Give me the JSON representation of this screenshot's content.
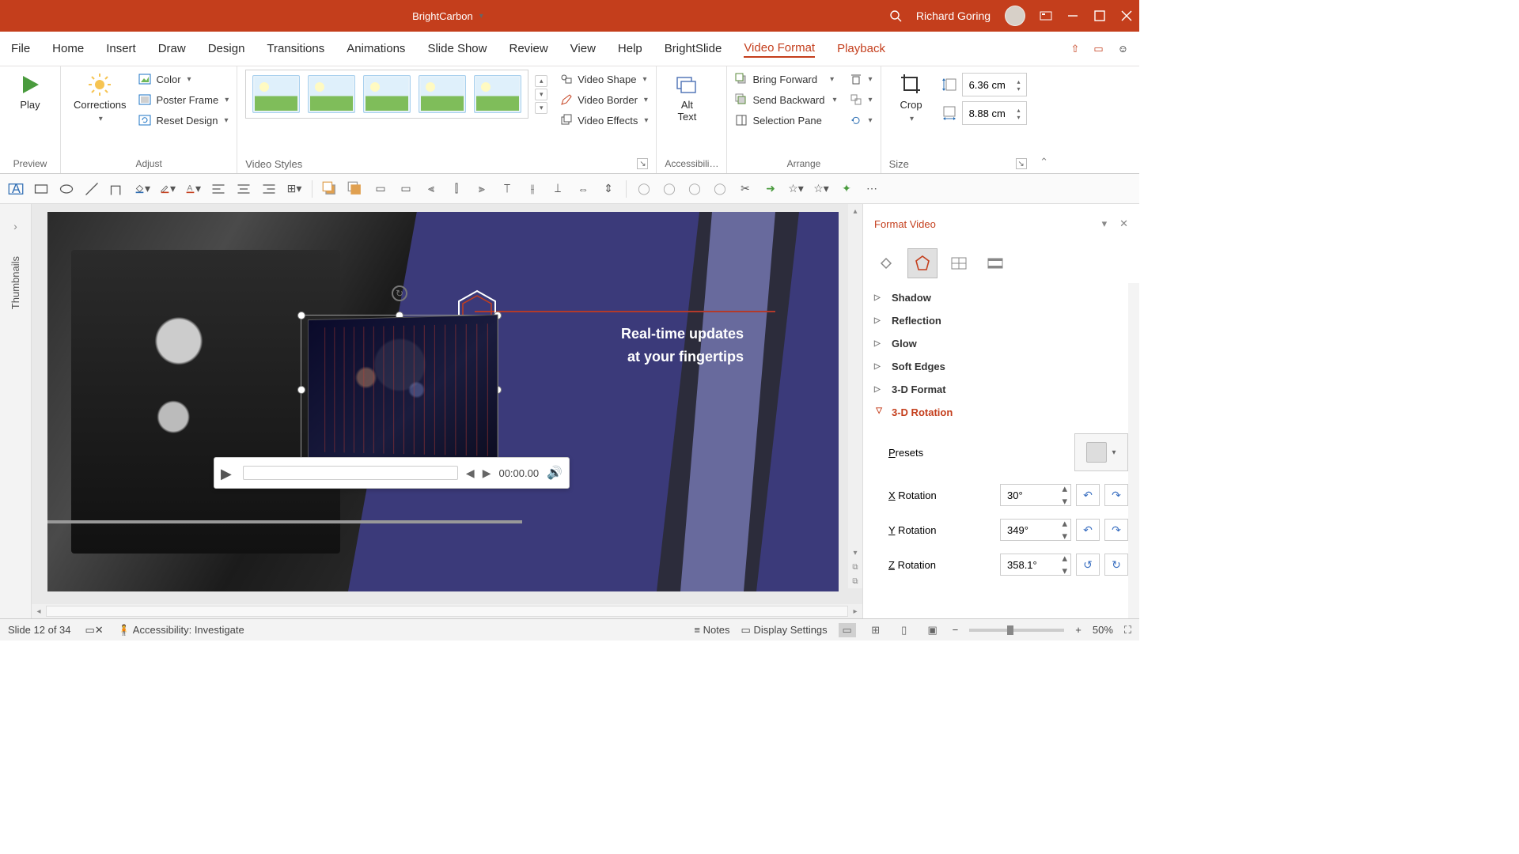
{
  "titlebar": {
    "title": "BrightCarbon",
    "user": "Richard Goring"
  },
  "tabs": [
    "File",
    "Home",
    "Insert",
    "Draw",
    "Design",
    "Transitions",
    "Animations",
    "Slide Show",
    "Review",
    "View",
    "Help",
    "BrightSlide",
    "Video Format",
    "Playback"
  ],
  "activeTab": "Video Format",
  "ribbon": {
    "preview": {
      "play": "Play",
      "group": "Preview"
    },
    "adjust": {
      "corrections": "Corrections",
      "color": "Color",
      "poster": "Poster Frame",
      "reset": "Reset Design",
      "group": "Adjust"
    },
    "videoStyles": {
      "shape": "Video Shape",
      "border": "Video Border",
      "effects": "Video Effects",
      "group": "Video Styles"
    },
    "accessibility": {
      "alt": "Alt\nText",
      "group": "Accessibili…"
    },
    "arrange": {
      "bringFwd": "Bring Forward",
      "sendBack": "Send Backward",
      "selPane": "Selection Pane",
      "group": "Arrange"
    },
    "size": {
      "crop": "Crop",
      "height": "6.36 cm",
      "width": "8.88 cm",
      "group": "Size"
    }
  },
  "slide": {
    "line1": "Real-time updates",
    "line2": "at your fingertips",
    "time": "00:00.00"
  },
  "thumbnails": "Thumbnails",
  "formatPane": {
    "title": "Format Video",
    "sections": [
      "Shadow",
      "Reflection",
      "Glow",
      "Soft Edges",
      "3-D Format",
      "3-D Rotation"
    ],
    "active": "3-D Rotation",
    "presets": "Presets",
    "xrot": {
      "label": "X Rotation",
      "value": "30°"
    },
    "yrot": {
      "label": "Y Rotation",
      "value": "349°"
    },
    "zrot": {
      "label": "Z Rotation",
      "value": "358.1°"
    }
  },
  "status": {
    "slide": "Slide 12 of 34",
    "accessibility": "Accessibility: Investigate",
    "notes": "Notes",
    "display": "Display Settings",
    "zoom": "50%"
  }
}
